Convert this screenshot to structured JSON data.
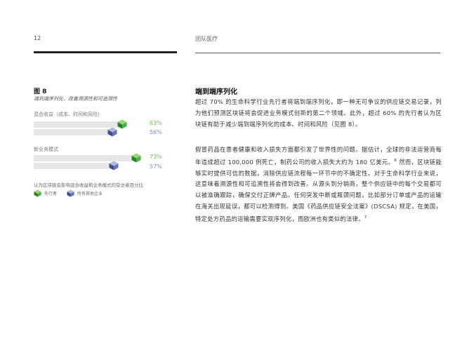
{
  "header": {
    "page_number": "12",
    "running_head": "团队医疗"
  },
  "figure": {
    "label": "图 8",
    "caption": "端到端序列化，改善溯源性和可追溯性",
    "groups": [
      {
        "title": "混合收益（成本、时间和风险）",
        "leaders_pct": "63%",
        "others_pct": "56%"
      },
      {
        "title": "新业务模式",
        "leaders_pct": "73%",
        "others_pct": "57%"
      }
    ],
    "footnote": "认为区块链会影响混合收益和业务模式的受访者百分比",
    "legend": {
      "leaders": "先行者",
      "others": "所有其他企业"
    },
    "colors": {
      "leaders": "#6cc04a",
      "others": "#7a8fc8"
    }
  },
  "chart_data": {
    "type": "bar",
    "categories": [
      "混合收益（成本、时间和风险）",
      "新业务模式"
    ],
    "series": [
      {
        "name": "先行者",
        "values": [
          63,
          73
        ]
      },
      {
        "name": "所有其他企业",
        "values": [
          56,
          57
        ]
      }
    ]
  },
  "article": {
    "heading": "端到端序列化",
    "paragraphs": [
      {
        "text": "超过 70% 的生命科学行业先行者将端到端序列化，即一种无可争议的供应链交易记录，列为他们预测区块链将会促进业务模式创新的第二个领域。此外，超过 60% 的先行者认为区块链有助于减少端到端序列化的成本、时间和风险（见图 8）。",
        "sup": ""
      },
      {
        "text": "假冒药品在患者健康和收入损失方面都引发了世界性的问题。据估计，全球的非法运营商每年造成超过 100,000 例死亡，制药公司的收入损失大约为 180 亿美元。",
        "sup": "6"
      },
      {
        "text": " 然而，区块链能够实时提供可信的数据，消除供应链流程每一环节中的不确定性。对于生命科学行业来说，这意味着溯源性和可追溯性将会得到改善。从源头到分销商，整个供应链中的每个交易都可以被准确跟踪，确保交付正牌产品。任何突发中断或瓶颈问题，比如部分订单或产品的运输在海关出现延误，都可以检测得到。美国《药品供应链安全法案》(DSCSA) 规定，在美国，特定处方药品的运输需要实现序列化，而欧洲也有类似的法律。",
        "sup": "7"
      }
    ]
  }
}
